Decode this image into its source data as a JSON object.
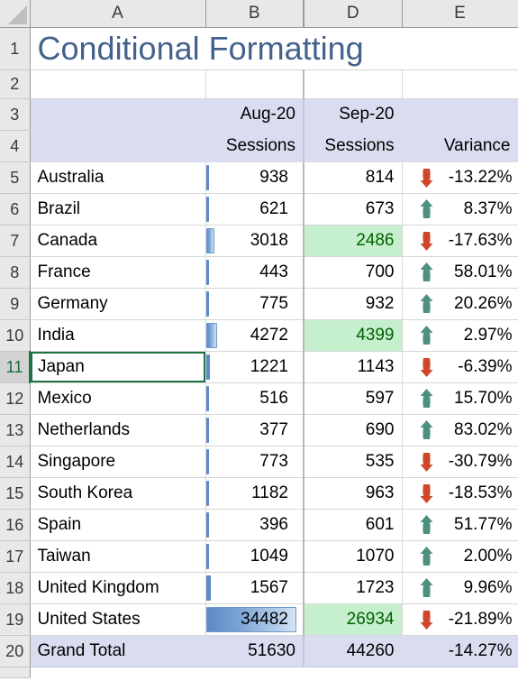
{
  "sheet": {
    "title": "Conditional Formatting",
    "column_headers": [
      "A",
      "B",
      "D",
      "E"
    ],
    "hidden_column_between": "C",
    "active_row": 11,
    "active_cell_label": "Japan",
    "row_numbers": [
      1,
      2,
      3,
      4,
      5,
      6,
      7,
      8,
      9,
      10,
      11,
      12,
      13,
      14,
      15,
      16,
      17,
      18,
      19,
      20
    ]
  },
  "colors": {
    "title_text": "#44618C",
    "band_header_bg": "#D9DDEF",
    "good_bg": "#C6EFCE",
    "good_text": "#006100",
    "bar_fill": "#5C8AC6",
    "arrow_up": "#4E9080",
    "arrow_down": "#D1462B",
    "rowhead_bg": "#E8E8E8",
    "active_rowhead_text": "#1A6B3C"
  },
  "table": {
    "header_top": {
      "a": "",
      "b": "Aug-20",
      "d": "Sep-20",
      "e": ""
    },
    "header_bottom": {
      "a": "",
      "b": "Sessions",
      "d": "Sessions",
      "e": "Variance"
    },
    "rows": [
      {
        "row": 5,
        "country": "Australia",
        "aug": "938",
        "aug_value": 938,
        "sep": "814",
        "sep_good": false,
        "variance": "-13.22%",
        "direction": "down"
      },
      {
        "row": 6,
        "country": "Brazil",
        "aug": "621",
        "aug_value": 621,
        "sep": "673",
        "sep_good": false,
        "variance": "8.37%",
        "direction": "up"
      },
      {
        "row": 7,
        "country": "Canada",
        "aug": "3018",
        "aug_value": 3018,
        "sep": "2486",
        "sep_good": true,
        "variance": "-17.63%",
        "direction": "down"
      },
      {
        "row": 8,
        "country": "France",
        "aug": "443",
        "aug_value": 443,
        "sep": "700",
        "sep_good": false,
        "variance": "58.01%",
        "direction": "up"
      },
      {
        "row": 9,
        "country": "Germany",
        "aug": "775",
        "aug_value": 775,
        "sep": "932",
        "sep_good": false,
        "variance": "20.26%",
        "direction": "up"
      },
      {
        "row": 10,
        "country": "India",
        "aug": "4272",
        "aug_value": 4272,
        "sep": "4399",
        "sep_good": true,
        "variance": "2.97%",
        "direction": "up"
      },
      {
        "row": 11,
        "country": "Japan",
        "aug": "1221",
        "aug_value": 1221,
        "sep": "1143",
        "sep_good": false,
        "variance": "-6.39%",
        "direction": "down"
      },
      {
        "row": 12,
        "country": "Mexico",
        "aug": "516",
        "aug_value": 516,
        "sep": "597",
        "sep_good": false,
        "variance": "15.70%",
        "direction": "up"
      },
      {
        "row": 13,
        "country": "Netherlands",
        "aug": "377",
        "aug_value": 377,
        "sep": "690",
        "sep_good": false,
        "variance": "83.02%",
        "direction": "up"
      },
      {
        "row": 14,
        "country": "Singapore",
        "aug": "773",
        "aug_value": 773,
        "sep": "535",
        "sep_good": false,
        "variance": "-30.79%",
        "direction": "down"
      },
      {
        "row": 15,
        "country": "South Korea",
        "aug": "1182",
        "aug_value": 1182,
        "sep": "963",
        "sep_good": false,
        "variance": "-18.53%",
        "direction": "down"
      },
      {
        "row": 16,
        "country": "Spain",
        "aug": "396",
        "aug_value": 396,
        "sep": "601",
        "sep_good": false,
        "variance": "51.77%",
        "direction": "up"
      },
      {
        "row": 17,
        "country": "Taiwan",
        "aug": "1049",
        "aug_value": 1049,
        "sep": "1070",
        "sep_good": false,
        "variance": "2.00%",
        "direction": "up"
      },
      {
        "row": 18,
        "country": "United Kingdom",
        "aug": "1567",
        "aug_value": 1567,
        "sep": "1723",
        "sep_good": false,
        "variance": "9.96%",
        "direction": "up"
      },
      {
        "row": 19,
        "country": "United States",
        "aug": "34482",
        "aug_value": 34482,
        "sep": "26934",
        "sep_good": true,
        "variance": "-21.89%",
        "direction": "down"
      }
    ],
    "total": {
      "row": 20,
      "label": "Grand Total",
      "aug": "51630",
      "sep": "44260",
      "variance": "-14.27%",
      "direction": "none"
    }
  }
}
